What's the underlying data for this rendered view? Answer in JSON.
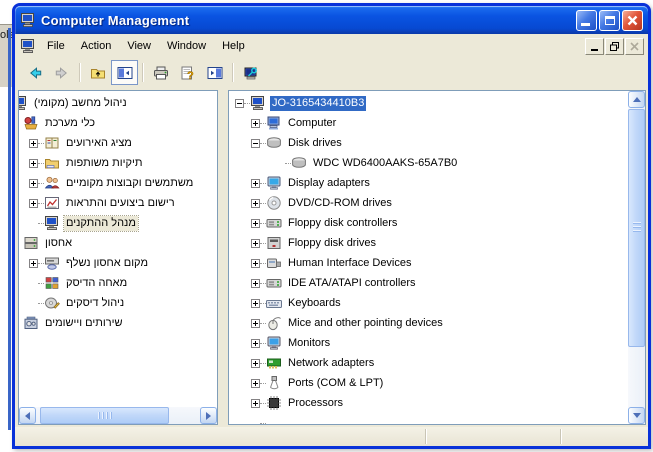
{
  "background": {
    "clipped_text": "ols"
  },
  "titlebar": {
    "title": "Computer Management",
    "icon": "computer-window-icon",
    "controls": [
      "minimize",
      "maximize",
      "close"
    ]
  },
  "menubar": {
    "icon": "computer-window-icon",
    "items": [
      {
        "label": "File"
      },
      {
        "label": "Action"
      },
      {
        "label": "View"
      },
      {
        "label": "Window"
      },
      {
        "label": "Help"
      }
    ],
    "doc_controls": [
      "minimize",
      "restore",
      "close-disabled"
    ]
  },
  "toolbar": {
    "buttons": [
      {
        "name": "back",
        "icon": "back-arrow-icon",
        "enabled": true,
        "separator_after": false
      },
      {
        "name": "forward",
        "icon": "forward-arrow-icon",
        "enabled": false,
        "separator_after": true
      },
      {
        "name": "up-one-level",
        "icon": "up-folder-icon",
        "enabled": true,
        "separator_after": false
      },
      {
        "name": "show-hide-console-tree",
        "icon": "console-tree-icon",
        "enabled": true,
        "pressed": true,
        "separator_after": true
      },
      {
        "name": "print",
        "icon": "printer-icon",
        "enabled": true,
        "separator_after": false
      },
      {
        "name": "help",
        "icon": "help-icon",
        "enabled": true,
        "separator_after": false
      },
      {
        "name": "show-hide-action-pane",
        "icon": "action-pane-icon",
        "enabled": true,
        "separator_after": true
      },
      {
        "name": "computer-key",
        "icon": "computer-key-icon",
        "enabled": true,
        "separator_after": false
      }
    ]
  },
  "console_tree": {
    "items": [
      {
        "name": "computer-management-local",
        "label": "ניהול מחשב (מקומי)",
        "icon": "computer-icon",
        "level": 0,
        "expand": "none",
        "clipped_icon": true,
        "selected": "none"
      },
      {
        "name": "system-tools",
        "label": "כלי מערכת",
        "icon": "system-tools-icon",
        "level": 0,
        "expand": "none",
        "selected": "none"
      },
      {
        "name": "event-viewer",
        "label": "מציג האירועים",
        "icon": "event-viewer-icon",
        "level": 1,
        "expand": "plus",
        "selected": "none"
      },
      {
        "name": "shared-folders",
        "label": "תיקיות משותפות",
        "icon": "shared-folders-icon",
        "level": 1,
        "expand": "plus",
        "selected": "none"
      },
      {
        "name": "local-users-and-groups",
        "label": "משתמשים וקבוצות מקומיים",
        "icon": "local-users-icon",
        "level": 1,
        "expand": "plus",
        "selected": "none"
      },
      {
        "name": "performance-logs-and-alerts",
        "label": "רישום ביצועים והתראות",
        "icon": "performance-logs-icon",
        "level": 1,
        "expand": "plus",
        "selected": "none"
      },
      {
        "name": "device-manager",
        "label": "מנהל ההתקנים",
        "icon": "computer-icon",
        "level": 1,
        "expand": "none",
        "selected": "inactive"
      },
      {
        "name": "storage",
        "label": "אחסון",
        "icon": "storage-icon",
        "level": 0,
        "expand": "none",
        "selected": "none"
      },
      {
        "name": "removable-storage",
        "label": "מקום אחסון נשלף",
        "icon": "removable-storage-icon",
        "level": 1,
        "expand": "plus",
        "selected": "none"
      },
      {
        "name": "disk-defragmenter",
        "label": "מאחה הדיסק",
        "icon": "defrag-icon",
        "level": 1,
        "expand": "none",
        "selected": "none"
      },
      {
        "name": "disk-management",
        "label": "ניהול דיסקים",
        "icon": "disk-management-icon",
        "level": 1,
        "expand": "none",
        "selected": "none"
      },
      {
        "name": "services-and-applications",
        "label": "שירותים ויישומים",
        "icon": "services-icon",
        "level": 0,
        "expand": "none",
        "selected": "none"
      }
    ]
  },
  "device_tree": {
    "items": [
      {
        "name": "computer-root",
        "label": "JO-3165434410B3",
        "icon": "computer-icon",
        "level": 0,
        "expand": "minus",
        "selected": "active"
      },
      {
        "name": "computer",
        "label": "Computer",
        "icon": "computer-device-icon",
        "level": 1,
        "expand": "plus",
        "selected": "none"
      },
      {
        "name": "disk-drives",
        "label": "Disk drives",
        "icon": "disk-drive-icon",
        "level": 1,
        "expand": "minus",
        "selected": "none"
      },
      {
        "name": "wdc-wd6400aaks-65a7b0",
        "label": "WDC WD6400AAKS-65A7B0",
        "icon": "disk-drive-icon",
        "level": 2,
        "expand": "none",
        "selected": "none"
      },
      {
        "name": "display-adapters",
        "label": "Display adapters",
        "icon": "display-adapter-icon",
        "level": 1,
        "expand": "plus",
        "selected": "none"
      },
      {
        "name": "dvd-cdrom-drives",
        "label": "DVD/CD-ROM drives",
        "icon": "cdrom-icon",
        "level": 1,
        "expand": "plus",
        "selected": "none"
      },
      {
        "name": "floppy-disk-controllers",
        "label": "Floppy disk controllers",
        "icon": "controller-icon",
        "level": 1,
        "expand": "plus",
        "selected": "none"
      },
      {
        "name": "floppy-disk-drives",
        "label": "Floppy disk drives",
        "icon": "floppy-drive-icon",
        "level": 1,
        "expand": "plus",
        "selected": "none"
      },
      {
        "name": "human-interface-devices",
        "label": "Human Interface Devices",
        "icon": "hid-icon",
        "level": 1,
        "expand": "plus",
        "selected": "none"
      },
      {
        "name": "ide-ata-atapi-controllers",
        "label": "IDE ATA/ATAPI controllers",
        "icon": "controller-icon",
        "level": 1,
        "expand": "plus",
        "selected": "none"
      },
      {
        "name": "keyboards",
        "label": "Keyboards",
        "icon": "keyboard-icon",
        "level": 1,
        "expand": "plus",
        "selected": "none"
      },
      {
        "name": "mice-and-other-pointing-devices",
        "label": "Mice and other pointing devices",
        "icon": "mouse-icon",
        "level": 1,
        "expand": "plus",
        "selected": "none"
      },
      {
        "name": "monitors",
        "label": "Monitors",
        "icon": "monitor-icon",
        "level": 1,
        "expand": "plus",
        "selected": "none"
      },
      {
        "name": "network-adapters",
        "label": "Network adapters",
        "icon": "network-adapter-icon",
        "level": 1,
        "expand": "plus",
        "selected": "none"
      },
      {
        "name": "ports-com-lpt",
        "label": "Ports (COM & LPT)",
        "icon": "ports-icon",
        "level": 1,
        "expand": "plus",
        "selected": "none"
      },
      {
        "name": "processors",
        "label": "Processors",
        "icon": "processor-icon",
        "level": 1,
        "expand": "plus",
        "selected": "none"
      },
      {
        "name": "clipped-bottom-device",
        "label": "",
        "icon": "clipped-device-icon",
        "level": 1,
        "expand": "none",
        "selected": "none"
      }
    ]
  },
  "colors": {
    "titlebar_blue": "#0A54E2",
    "window_border": "#0831D9",
    "chrome_beige": "#ECE9D8",
    "selection_active": "#316AC5",
    "selection_inactive": "#ECE9D8",
    "close_red": "#E2563A"
  }
}
